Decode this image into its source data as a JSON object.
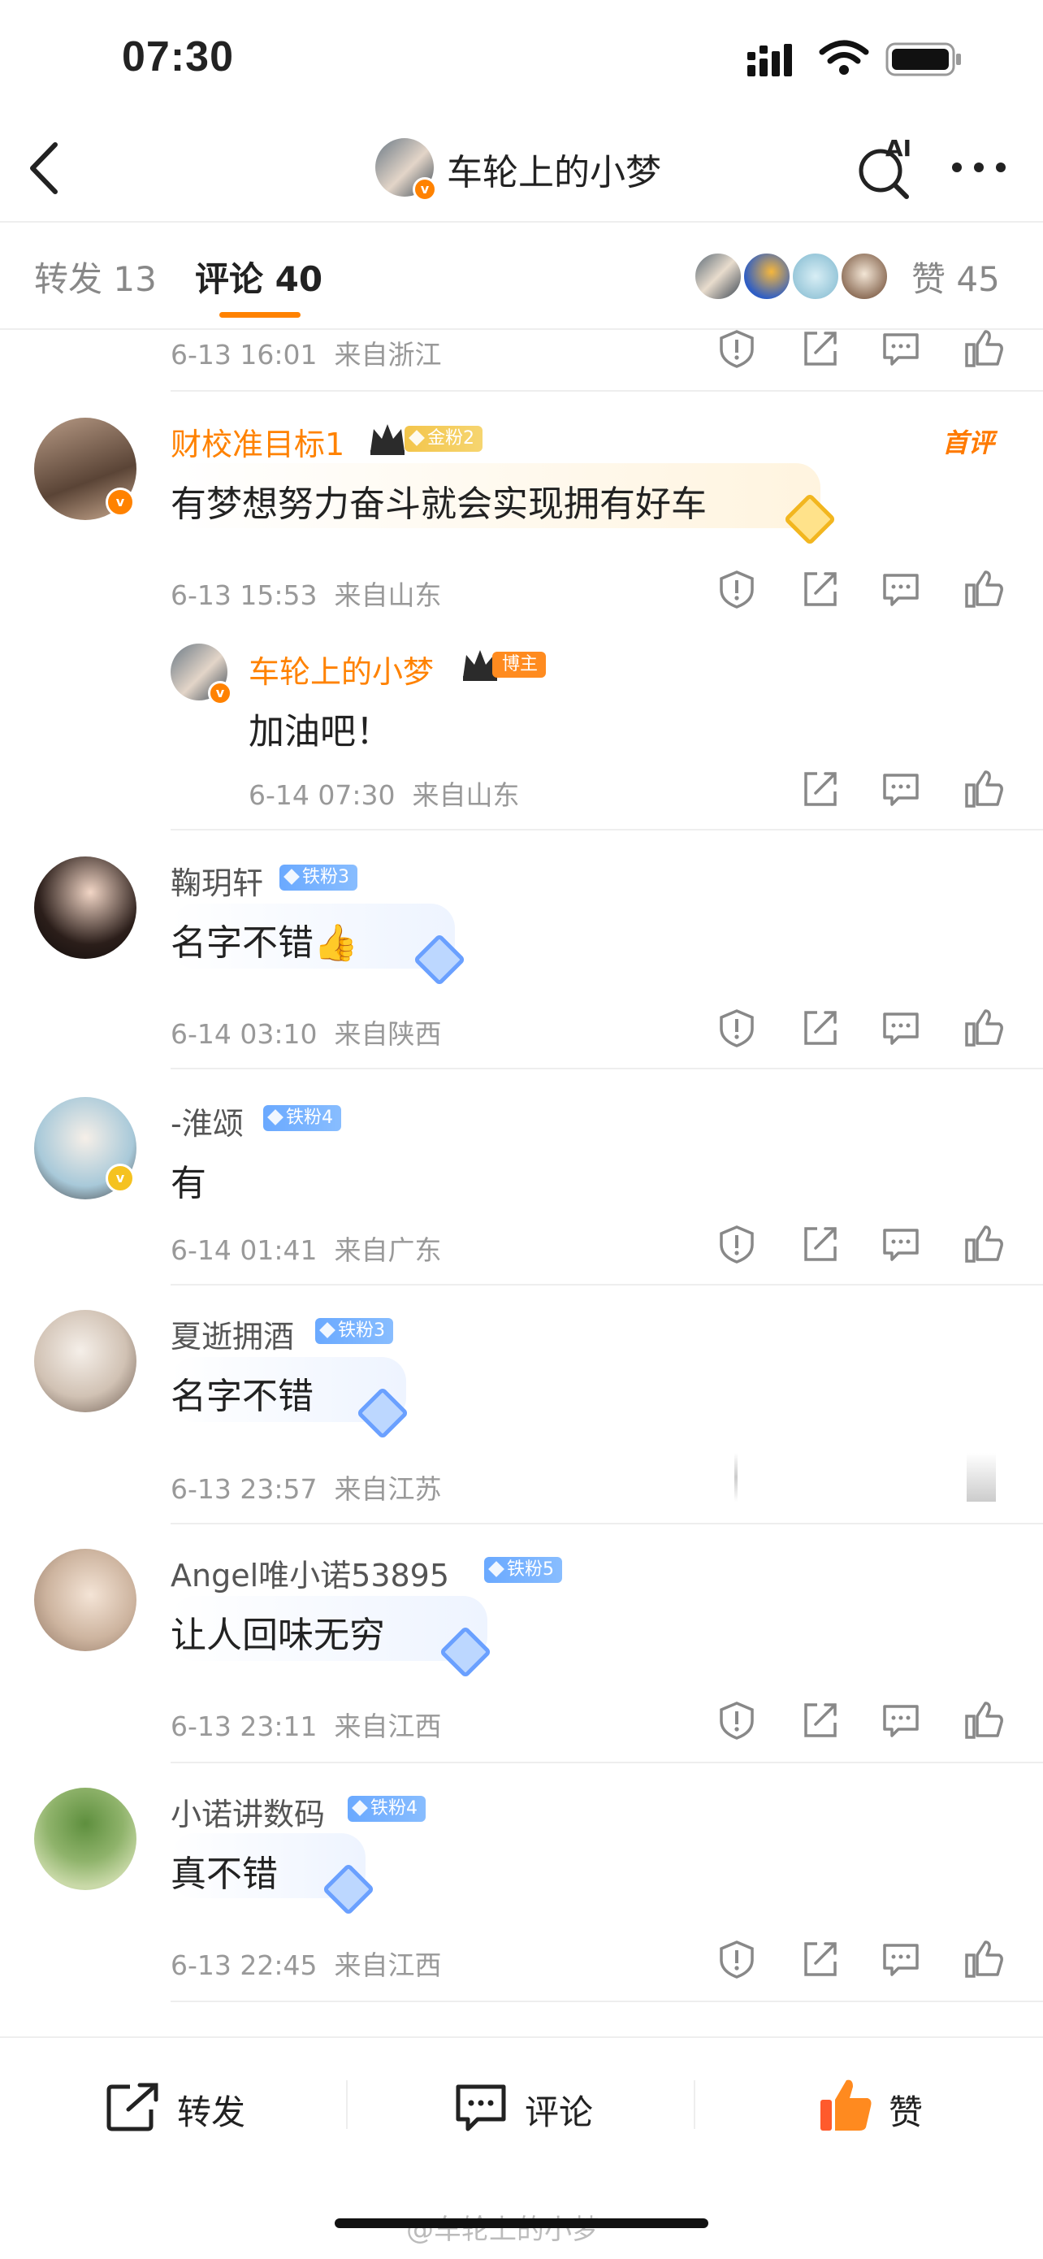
{
  "status_bar": {
    "time": "07:30"
  },
  "header": {
    "title": "车轮上的小梦",
    "ai_label": "AI"
  },
  "tabs": {
    "repost": "转发 13",
    "comments": "评论 40",
    "likes": "赞 45"
  },
  "partial_top": {
    "time": "6-13 16:01",
    "location": "来自浙江"
  },
  "comments": [
    {
      "name": "财校准目标1",
      "badge": "金粉2",
      "text": "有梦想努力奋斗就会实现拥有好车",
      "time": "6-13 15:53",
      "location": "来自山东",
      "tag": "首评"
    },
    {
      "name": "车轮上的小梦",
      "badge": "博主",
      "text": "加油吧！",
      "time": "6-14 07:30",
      "location": "来自山东"
    },
    {
      "name": "鞠玥轩",
      "badge": "铁粉3",
      "text": "名字不错👍",
      "time": "6-14 03:10",
      "location": "来自陕西"
    },
    {
      "name": "-淮颂",
      "badge": "铁粉4",
      "text": "有",
      "time": "6-14 01:41",
      "location": "来自广东"
    },
    {
      "name": "夏逝拥酒",
      "badge": "铁粉3",
      "text": "名字不错",
      "time": "6-13 23:57",
      "location": "来自江苏"
    },
    {
      "name": "Angel唯小诺53895",
      "badge": "铁粉5",
      "text": "让人回味无穷",
      "time": "6-13 23:11",
      "location": "来自江西"
    },
    {
      "name": "小诺讲数码",
      "badge": "铁粉4",
      "text": "真不错",
      "time": "6-13 22:45",
      "location": "来自江西"
    }
  ],
  "bottom_bar": {
    "repost": "转发",
    "comment": "评论",
    "like": "赞"
  },
  "watermark": "@车轮上的小梦",
  "colors": {
    "accent": "#ff8200",
    "iron_badge": "#6aa9ff",
    "gold_badge": "#f3c54b"
  }
}
